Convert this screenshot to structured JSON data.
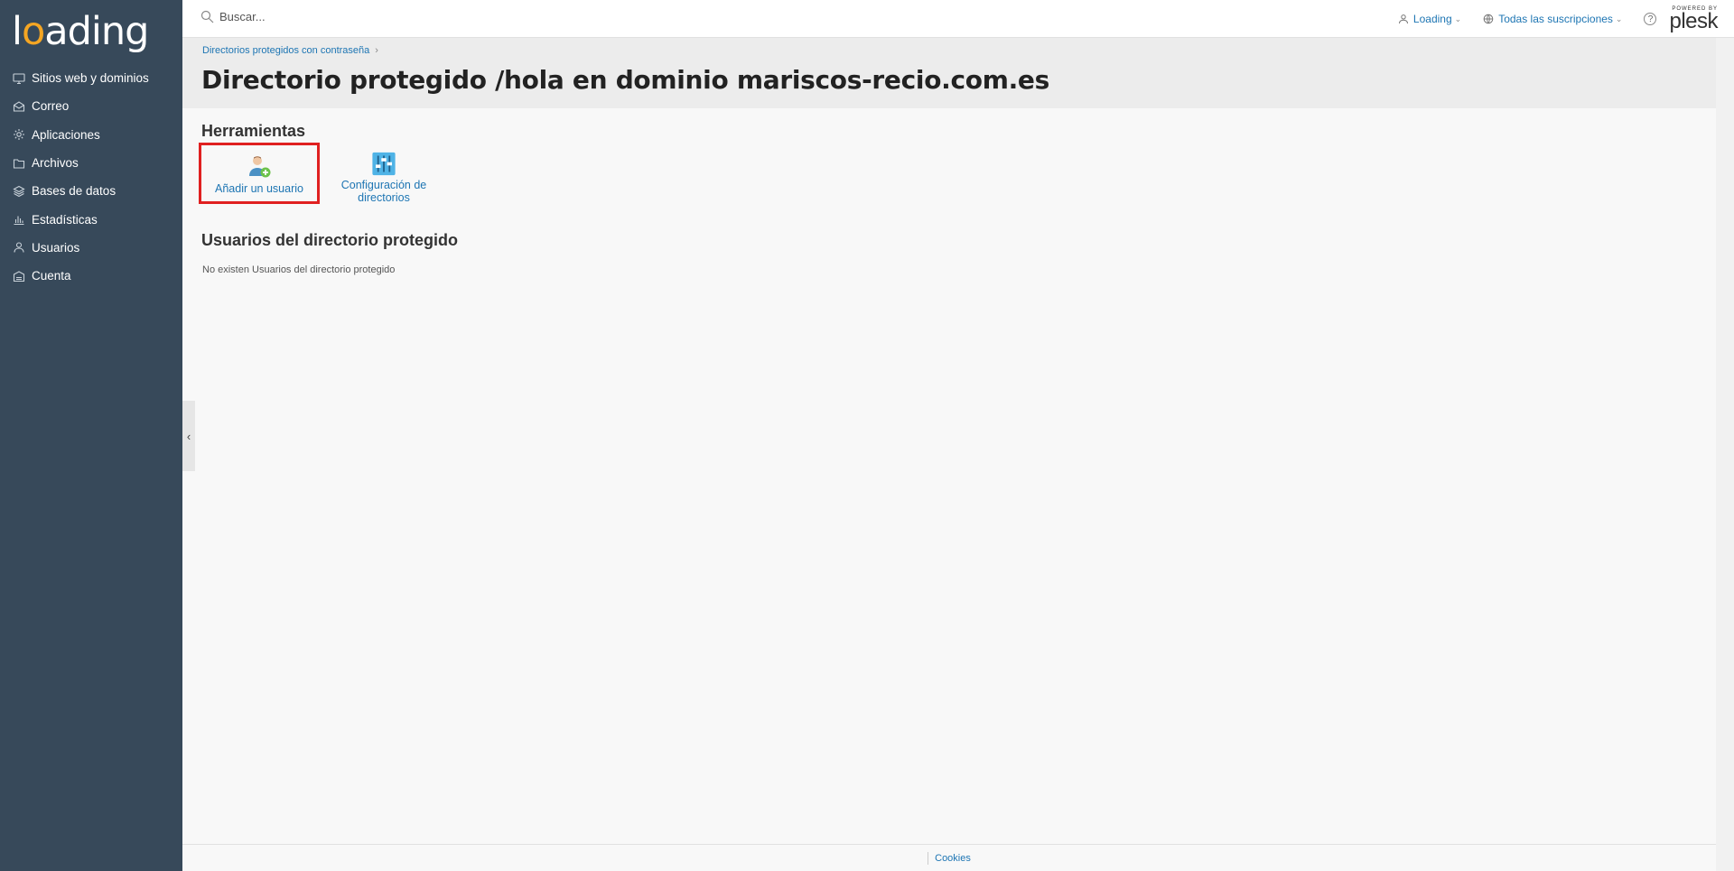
{
  "brand": {
    "logo_prefix": "l",
    "logo_o": "o",
    "logo_suffix": "ading",
    "accent": "#f5a623"
  },
  "sidebar": {
    "items": [
      {
        "label": "Sitios web y dominios",
        "icon": "monitor-icon"
      },
      {
        "label": "Correo",
        "icon": "envelope-icon"
      },
      {
        "label": "Aplicaciones",
        "icon": "gear-icon"
      },
      {
        "label": "Archivos",
        "icon": "folder-icon"
      },
      {
        "label": "Bases de datos",
        "icon": "layers-icon"
      },
      {
        "label": "Estadísticas",
        "icon": "bar-chart-icon"
      },
      {
        "label": "Usuarios",
        "icon": "user-icon"
      },
      {
        "label": "Cuenta",
        "icon": "account-icon"
      }
    ]
  },
  "topbar": {
    "search_placeholder": "Buscar...",
    "user_label": "Loading",
    "subscriptions_label": "Todas las suscripciones",
    "help_label": "?",
    "powered_by": "POWERED BY",
    "plesk": "plesk"
  },
  "header": {
    "breadcrumb": "Directorios protegidos con contraseña",
    "title": "Directorio protegido /hola en dominio mariscos-recio.com.es"
  },
  "tools": {
    "title": "Herramientas",
    "add_user": "Añadir un usuario",
    "config_line1": "Configuración de",
    "config_line2": "directorios"
  },
  "users": {
    "title": "Usuarios del directorio protegido",
    "empty": "No existen Usuarios del directorio protegido"
  },
  "footer": {
    "cookies": "Cookies"
  },
  "colors": {
    "sidebar_bg": "#37495a",
    "link": "#1d75b3",
    "highlight": "#e02020"
  }
}
